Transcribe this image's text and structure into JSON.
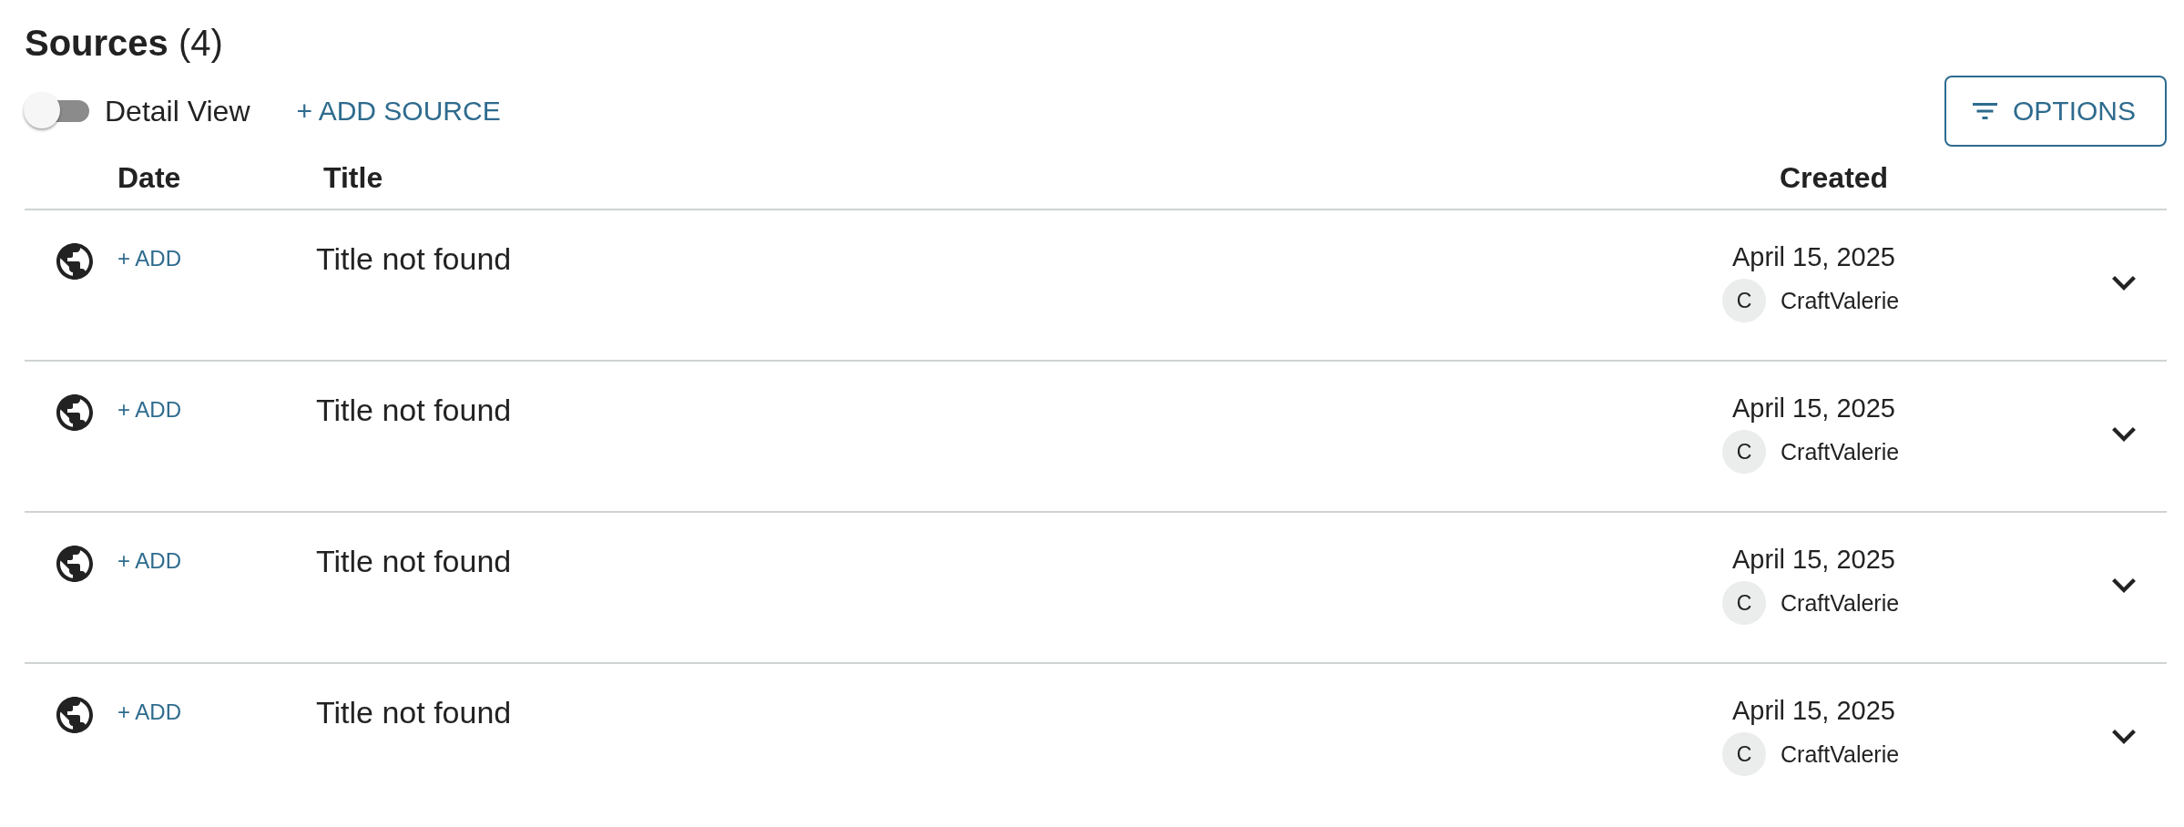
{
  "header": {
    "title": "**Sources** (4)"
  },
  "toolbar": {
    "detail_view": {
      "label": "Detail View",
      "on": false
    },
    "add_source": "+ ADD SOURCE",
    "options": "OPTIONS"
  },
  "table": {
    "columns": [
      "Date",
      "Title",
      "Created"
    ],
    "rows": [
      {
        "date_action": "+ ADD",
        "title": "Title not found",
        "created": "April 15, 2025",
        "creator_initial": "C",
        "creator": "CraftValerie",
        "expanded": false
      },
      {
        "date_action": "+ ADD",
        "title": "Title not found",
        "created": "April 15, 2025",
        "creator_initial": "C",
        "creator": "CraftValerie",
        "expanded": false
      },
      {
        "date_action": "+ ADD",
        "title": "Title not found",
        "created": "April 15, 2025",
        "creator_initial": "C",
        "creator": "CraftValerie",
        "expanded": false
      },
      {
        "date_action": "+ ADD",
        "title": "Title not found",
        "created": "April 15, 2025",
        "creator_initial": "C",
        "creator": "CraftValerie",
        "expanded": false
      }
    ]
  }
}
